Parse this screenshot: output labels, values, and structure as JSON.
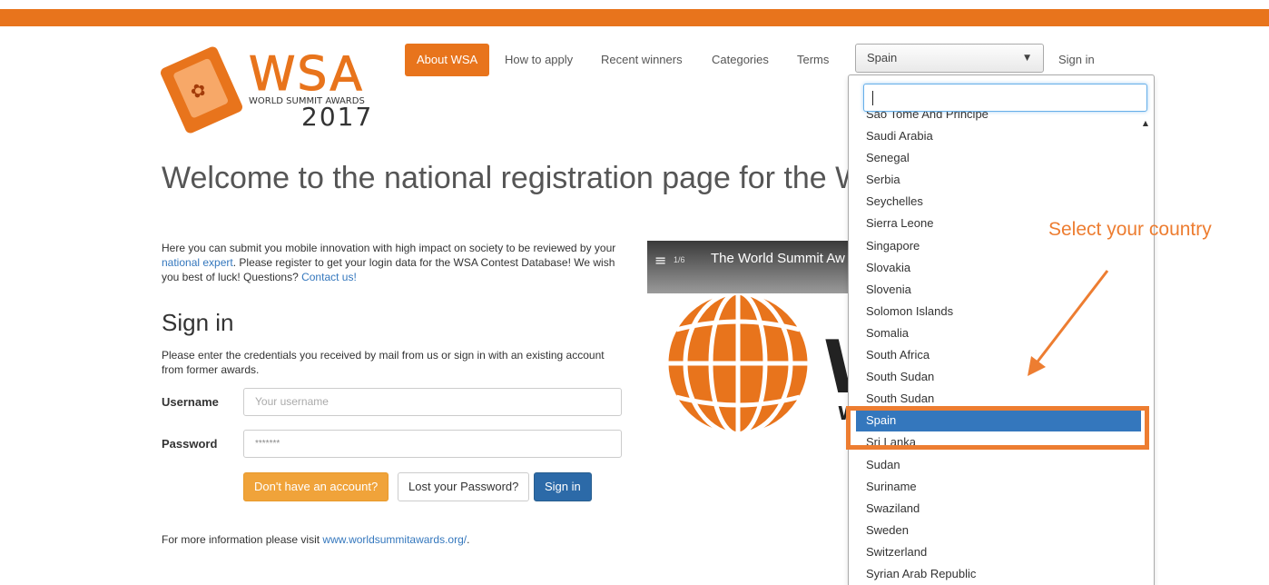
{
  "colors": {
    "brand_orange": "#e8741c",
    "annotation_orange": "#ed7d31",
    "select_blue": "#3477bd",
    "primary_blue": "#2c6aa8",
    "warning_orange": "#f0a33a"
  },
  "logo": {
    "wordmark": "WSA",
    "subtitle": "WORLD SUMMIT AWARDS",
    "year": "2017"
  },
  "nav": {
    "items": [
      "About WSA",
      "How to apply",
      "Recent winners",
      "Categories",
      "Terms"
    ],
    "country_selected": "Spain",
    "signin": "Sign in"
  },
  "dropdown": {
    "search_value": "",
    "options": [
      "Sao Tome And Principe",
      "Saudi Arabia",
      "Senegal",
      "Serbia",
      "Seychelles",
      "Sierra Leone",
      "Singapore",
      "Slovakia",
      "Slovenia",
      "Solomon Islands",
      "Somalia",
      "South Africa",
      "South Sudan",
      "South Sudan",
      "Spain",
      "Sri Lanka",
      "Sudan",
      "Suriname",
      "Swaziland",
      "Sweden",
      "Switzerland",
      "Syrian Arab Republic"
    ],
    "selected": "Spain"
  },
  "main": {
    "heading": "Welcome to the national registration page for the W",
    "intro_part1": "Here you can submit you mobile innovation with high impact on society to be reviewed by your ",
    "intro_link1": "national expert",
    "intro_part2": ". Please register to get your login data for the WSA Contest Database! We wish you best of luck! Questions? ",
    "intro_link2": "Contact us!",
    "signin_title": "Sign in",
    "signin_desc": "Please enter the credentials you received by mail from us or sign in with an existing account from former awards.",
    "username_label": "Username",
    "username_placeholder": "Your username",
    "password_label": "Password",
    "password_value": "*******",
    "btn_register": "Don't have an account?",
    "btn_lost": "Lost your Password?",
    "btn_signin": "Sign in",
    "footer_text": "For more information please visit ",
    "footer_link": "www.worldsummitawards.org/",
    "footer_end": "."
  },
  "video": {
    "icon": "playlist-icon",
    "count": "1/6",
    "title": "The World Summit Aw"
  },
  "annotation": {
    "text": "Select your country"
  }
}
